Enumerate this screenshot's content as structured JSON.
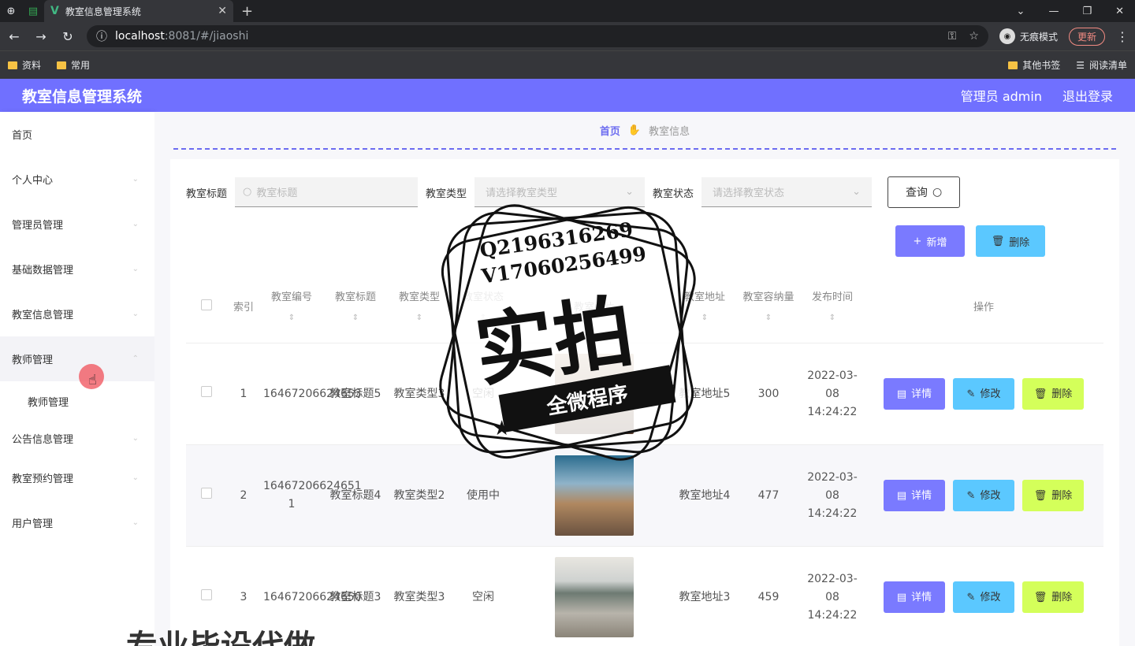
{
  "browser": {
    "tab_title": "教室信息管理系统",
    "url_host": "localhost",
    "url_path": ":8081/#/jiaoshi",
    "incognito_label": "无痕模式",
    "update_label": "更新",
    "bookmarks": [
      "资料",
      "常用"
    ],
    "bookmarks_right": [
      "其他书签",
      "阅读清单"
    ]
  },
  "header": {
    "title": "教室信息管理系统",
    "user": "管理员 admin",
    "logout": "退出登录",
    "color": "#7070ff"
  },
  "sidebar": {
    "items": [
      {
        "label": "首页"
      },
      {
        "label": "个人中心"
      },
      {
        "label": "管理员管理"
      },
      {
        "label": "基础数据管理"
      },
      {
        "label": "教室信息管理"
      },
      {
        "label": "教师管理"
      },
      {
        "label": "公告信息管理"
      },
      {
        "label": "教室预约管理"
      },
      {
        "label": "用户管理"
      }
    ],
    "sub_item": "教师管理"
  },
  "breadcrumb": {
    "home": "首页",
    "current": "教室信息"
  },
  "search": {
    "title_label": "教室标题",
    "title_placeholder": "教室标题",
    "type_label": "教室类型",
    "type_placeholder": "请选择教室类型",
    "status_label": "教室状态",
    "status_placeholder": "请选择教室状态",
    "query_label": "查询"
  },
  "actions": {
    "add": "新增",
    "delete": "删除"
  },
  "table": {
    "headers": [
      "索引",
      "教室编号",
      "教室标题",
      "教室类型",
      "教室状态",
      "教室照片",
      "教室地址",
      "教室容纳量",
      "发布时间",
      "操作"
    ],
    "rows": [
      {
        "index": "1",
        "code": "16467206624653",
        "title": "教室标题5",
        "type": "教室类型3",
        "status": "空闲",
        "address": "教室地址5",
        "capacity": "300",
        "time": "2022-03-08 14:24:22"
      },
      {
        "index": "2",
        "code": "16467206624651 1",
        "title": "教室标题4",
        "type": "教室类型2",
        "status": "使用中",
        "address": "教室地址4",
        "capacity": "477",
        "time": "2022-03-08 14:24:22"
      },
      {
        "index": "3",
        "code": "16467206624650",
        "title": "教室标题3",
        "type": "教室类型3",
        "status": "空闲",
        "address": "教室地址3",
        "capacity": "459",
        "time": "2022-03-08 14:24:22"
      }
    ],
    "ops": {
      "detail": "详情",
      "edit": "修改",
      "delete": "删除"
    }
  },
  "watermark": {
    "q": "Q2196316269",
    "v": "V17060256499",
    "big": "实拍",
    "ribbon": "全微程序",
    "bottom": "专业毕设代做"
  }
}
